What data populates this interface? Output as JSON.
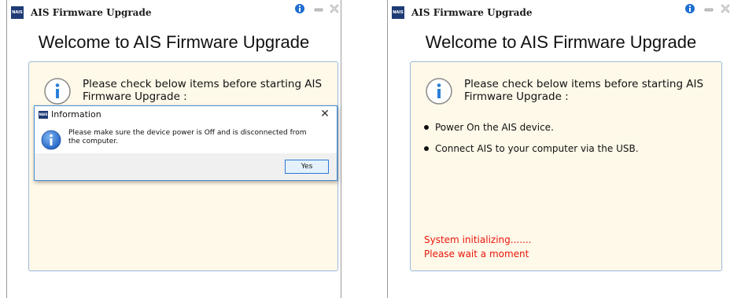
{
  "window_left": {
    "title": "AIS Firmware Upgrade",
    "logo_text": "NAIS",
    "welcome": "Welcome to AIS Firmware Upgrade",
    "check_text": "Please check below items before starting AIS Firmware Upgrade :",
    "dialog": {
      "title": "Information",
      "message": "Please make sure the device power is Off and is disconnected from the computer.",
      "yes_label": "Yes",
      "close_glyph": "✕"
    }
  },
  "window_right": {
    "title": "AIS Firmware Upgrade",
    "logo_text": "NAIS",
    "welcome": "Welcome to AIS Firmware Upgrade",
    "check_text": "Please check below items before starting AIS Firmware Upgrade :",
    "items": [
      "Power On the AIS device.",
      "Connect AIS to your computer via the USB."
    ],
    "status": [
      "System initializing.......",
      "Please wait a moment"
    ]
  },
  "colors": {
    "panel_bg": "#fff9e9",
    "panel_border": "#9ab9db",
    "status_red": "#e8160b",
    "accent_blue": "#1f6fd1"
  },
  "icons": [
    "info-icon",
    "minimize-icon",
    "close-icon"
  ]
}
